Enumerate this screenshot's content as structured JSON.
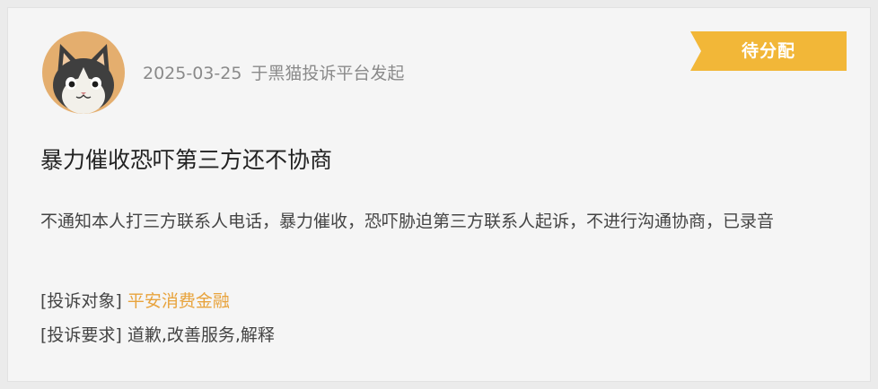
{
  "complaint": {
    "avatar": "cat-avatar",
    "date": "2025-03-25",
    "source": "于黑猫投诉平台发起",
    "status": "待分配",
    "title": "暴力催收恐吓第三方还不协商",
    "description": "不通知本人打三方联系人电话，暴力催收，恐吓胁迫第三方联系人起诉，不进行沟通协商，已录音",
    "target_label": "[投诉对象]",
    "target_value": "平安消费金融",
    "demand_label": "[投诉要求]",
    "demand_value": "道歉,改善服务,解释"
  },
  "colors": {
    "status_tag": "#f2b738",
    "link": "#e8a33c",
    "avatar_bg": "#e4ae6e"
  }
}
